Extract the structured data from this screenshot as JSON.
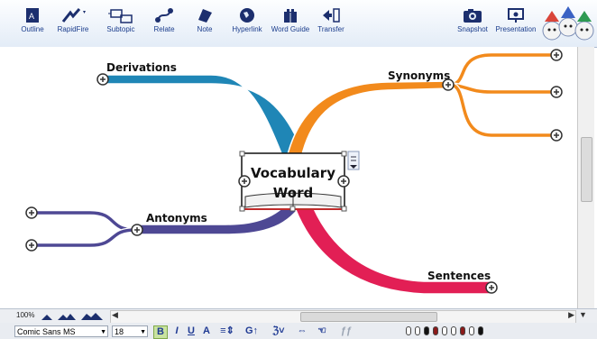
{
  "toolbar": {
    "outline": "Outline",
    "rapidfire": "RapidFire",
    "subtopic": "Subtopic",
    "relate": "Relate",
    "note": "Note",
    "hyperlink": "Hyperlink",
    "word_guide": "Word Guide",
    "transfer": "Transfer",
    "snapshot": "Snapshot",
    "presentation": "Presentation"
  },
  "map": {
    "central_line1": "Vocabulary",
    "central_line2": "Word",
    "branches": [
      "Derivations",
      "Synonyms",
      "Antonyms",
      "Sentences"
    ],
    "colors": {
      "derivations": "#1f86b6",
      "synonyms": "#f28a1c",
      "antonyms": "#4e4894",
      "sentences": "#e21f55"
    }
  },
  "status": {
    "zoom": "100%"
  },
  "format": {
    "font": "Comic Sans MS",
    "size": "18"
  },
  "edge": {
    "left": "o",
    "right": "e"
  }
}
